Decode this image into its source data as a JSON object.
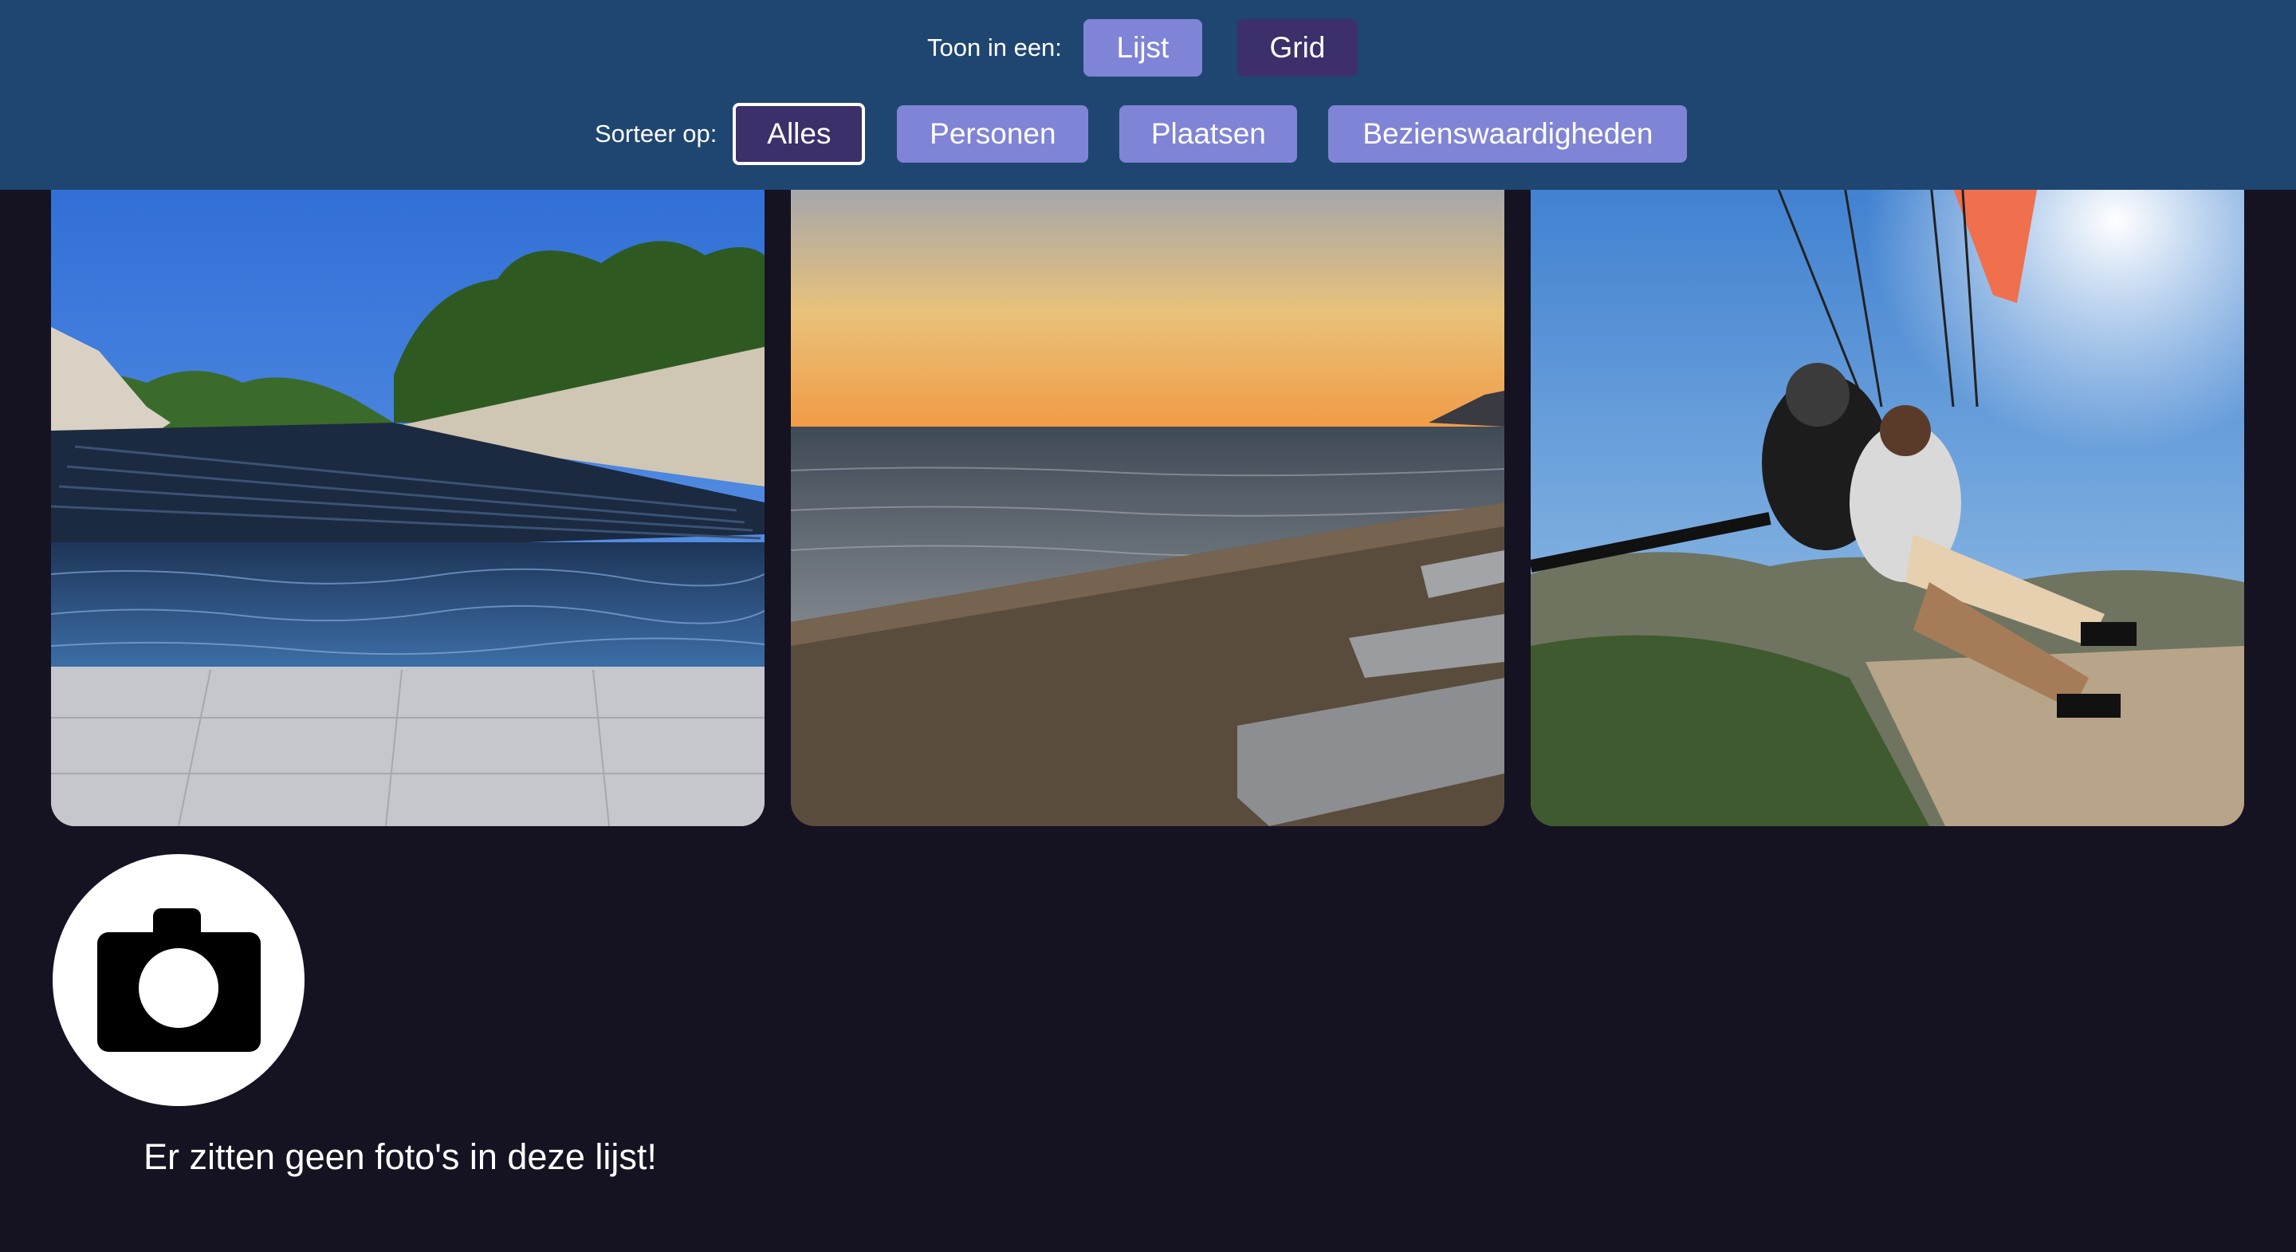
{
  "header": {
    "view_label": "Toon in een:",
    "view_options": [
      "Lijst",
      "Grid"
    ],
    "sort_label": "Sorteer op:",
    "sort_options": [
      "Alles",
      "Personen",
      "Plaatsen",
      "Bezienswaardigheden"
    ],
    "selected_sort": "Alles"
  },
  "photos": [
    {
      "subject": "waterfall steps"
    },
    {
      "subject": "beach sunset"
    },
    {
      "subject": "tandem paragliding"
    }
  ],
  "empty_state": {
    "icon": "camera-icon",
    "message": "Er zitten geen foto's in deze lijst!"
  },
  "colors": {
    "header_bg": "#1f4670",
    "page_bg": "#151221",
    "button": "#7f84d6",
    "button_dark": "#3c2f6a"
  }
}
